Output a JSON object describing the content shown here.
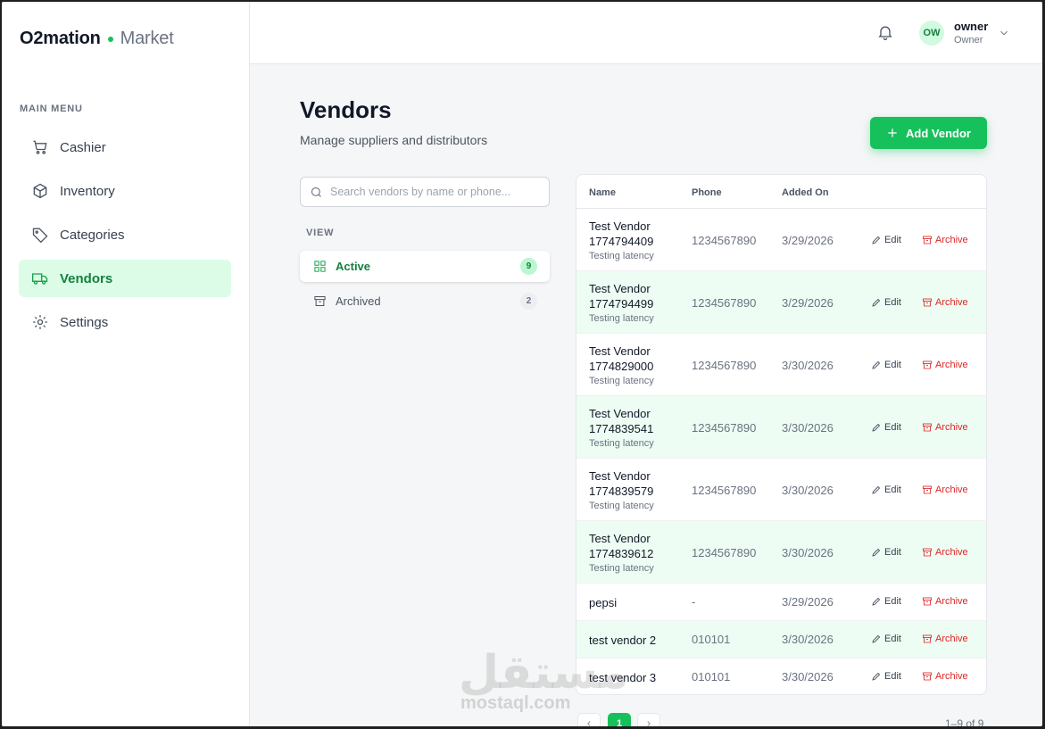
{
  "brand": {
    "name": "O2mation",
    "suffix": "Market",
    "accent": "#16c15b"
  },
  "sidebar": {
    "section_title": "MAIN MENU",
    "items": [
      {
        "label": "Cashier",
        "icon": "cart-icon"
      },
      {
        "label": "Inventory",
        "icon": "box-icon"
      },
      {
        "label": "Categories",
        "icon": "tag-icon"
      },
      {
        "label": "Vendors",
        "icon": "truck-icon",
        "active": true
      },
      {
        "label": "Settings",
        "icon": "gear-icon"
      }
    ]
  },
  "topbar": {
    "notifications_icon": "bell-icon",
    "user": {
      "initials": "OW",
      "name": "owner",
      "role": "Owner"
    }
  },
  "page": {
    "title": "Vendors",
    "subtitle": "Manage suppliers and distributors",
    "add_button": "Add Vendor"
  },
  "filters": {
    "search_placeholder": "Search vendors by name or phone...",
    "view_label": "VIEW",
    "views": [
      {
        "label": "Active",
        "count": "9",
        "active": true
      },
      {
        "label": "Archived",
        "count": "2"
      }
    ]
  },
  "table": {
    "columns": [
      "Name",
      "Phone",
      "Added On"
    ],
    "edit_label": "Edit",
    "archive_label": "Archive",
    "rows": [
      {
        "name": "Test Vendor 1774794409",
        "note": "Testing latency",
        "phone": "1234567890",
        "added": "3/29/2026"
      },
      {
        "name": "Test Vendor 1774794499",
        "note": "Testing latency",
        "phone": "1234567890",
        "added": "3/29/2026"
      },
      {
        "name": "Test Vendor 1774829000",
        "note": "Testing latency",
        "phone": "1234567890",
        "added": "3/30/2026"
      },
      {
        "name": "Test Vendor 1774839541",
        "note": "Testing latency",
        "phone": "1234567890",
        "added": "3/30/2026"
      },
      {
        "name": "Test Vendor 1774839579",
        "note": "Testing latency",
        "phone": "1234567890",
        "added": "3/30/2026"
      },
      {
        "name": "Test Vendor 1774839612",
        "note": "Testing latency",
        "phone": "1234567890",
        "added": "3/30/2026"
      },
      {
        "name": "pepsi",
        "note": "",
        "phone": "-",
        "added": "3/29/2026"
      },
      {
        "name": "test vendor 2",
        "note": "",
        "phone": "010101",
        "added": "3/30/2026"
      },
      {
        "name": "test vendor 3",
        "note": "",
        "phone": "010101",
        "added": "3/30/2026"
      }
    ]
  },
  "pagination": {
    "current": "1",
    "info": "1–9 of 9"
  },
  "watermark": {
    "arabic": "مستقل",
    "latin": "mostaql.com"
  }
}
